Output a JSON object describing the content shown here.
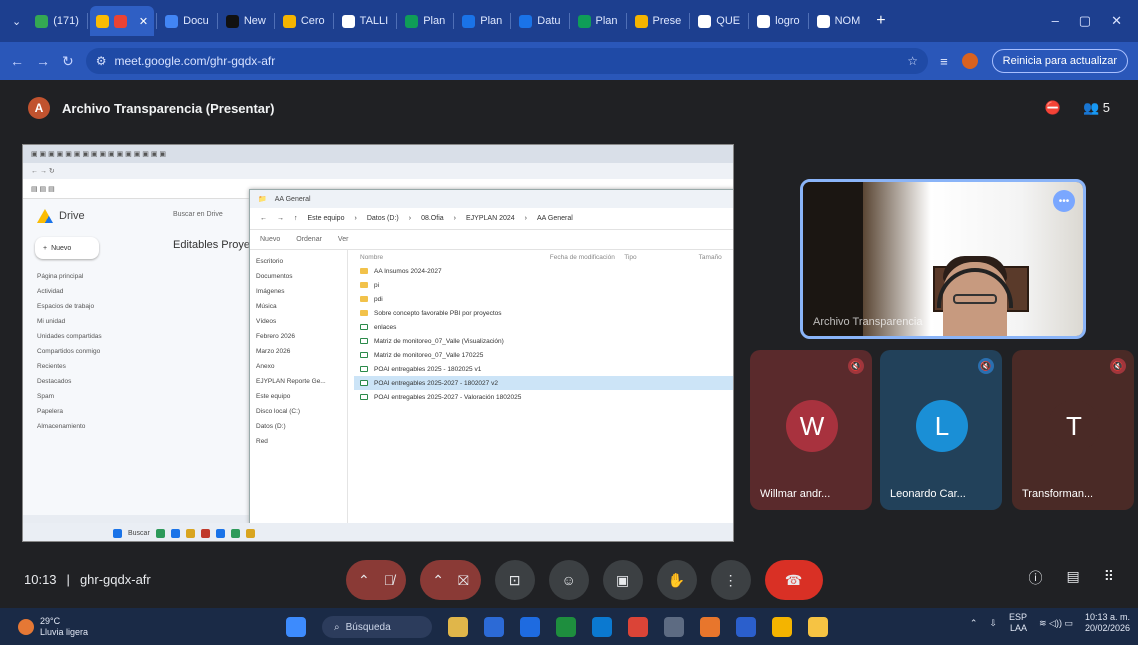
{
  "browser": {
    "tabs": [
      {
        "label": "(171)",
        "color": "#34a853",
        "active": false
      },
      {
        "label": "",
        "color": "#fbbc04",
        "active": true
      },
      {
        "label": "Docu",
        "color": "#4285f4",
        "active": false
      },
      {
        "label": "New",
        "color": "#111111",
        "active": false
      },
      {
        "label": "Cero",
        "color": "#f4b400",
        "active": false
      },
      {
        "label": "TALLI",
        "color": "#ffffff",
        "active": false
      },
      {
        "label": "Plan",
        "color": "#0f9d58",
        "active": false
      },
      {
        "label": "Plan",
        "color": "#1a73e8",
        "active": false
      },
      {
        "label": "Datu",
        "color": "#1a73e8",
        "active": false
      },
      {
        "label": "Plan",
        "color": "#0f9d58",
        "active": false
      },
      {
        "label": "Prese",
        "color": "#f4b400",
        "active": false
      },
      {
        "label": "QUE",
        "color": "#ffffff",
        "active": false
      },
      {
        "label": "logro",
        "color": "#ffffff",
        "active": false
      },
      {
        "label": "NOM",
        "color": "#ffffff",
        "active": false
      }
    ],
    "url": "meet.google.com/ghr-gqdx-afr",
    "update_label": "Reinicia para actualizar"
  },
  "meet": {
    "presenter_initial": "A",
    "presenting_title": "Archivo Transparencia (Presentar)",
    "participant_count": "5",
    "meeting_time": "10:13",
    "meeting_separator": "|",
    "meeting_code": "ghr-gqdx-afr",
    "self_tile": {
      "name": "Archivo Transparencia"
    },
    "participants": [
      {
        "initial": "W",
        "name": "Willmar andr...",
        "avatar_color": "#a8323e",
        "tile_color": "#5a2a2c",
        "mic_color": "#a0363c"
      },
      {
        "initial": "L",
        "name": "Leonardo Car...",
        "avatar_color": "#1a8fd6",
        "tile_color": "#22415a",
        "mic_color": "#2a6fb0"
      },
      {
        "initial": "T",
        "name": "Transforman...",
        "avatar_color": "#4a2a26",
        "tile_color": "#4a2a26",
        "mic_color": "#a0363c"
      }
    ]
  },
  "shared_screen": {
    "drive": {
      "logo": "Drive",
      "new_label": "Nuevo",
      "search_placeholder": "Buscar en Drive",
      "title": "Editables Proye",
      "nav": [
        "Página principal",
        "Actividad",
        "Espacios de trabajo",
        "Mi unidad",
        "Unidades compartidas",
        "Compartidos conmigo",
        "Recientes",
        "Destacados",
        "Spam",
        "Papelera",
        "Almacenamiento"
      ]
    },
    "explorer": {
      "window_title": "AA General",
      "breadcrumb": [
        "Este equipo",
        "Datos (D:)",
        "08.Ofia",
        "EJYPLAN 2024",
        "AA General"
      ],
      "toolbar": [
        "Nuevo",
        "Ordenar",
        "Ver"
      ],
      "columns": [
        "Nombre",
        "Fecha de modificación",
        "Tipo",
        "Tamaño"
      ],
      "left_nav": [
        "Escritorio",
        "Documentos",
        "Imágenes",
        "Música",
        "Vídeos",
        "Febrero 2026",
        "Marzo 2026",
        "Anexo",
        "EJYPLAN Reporte Ge...",
        "Este equipo",
        "Disco local (C:)",
        "Datos (D:)",
        "Red"
      ],
      "files": [
        {
          "name": "AA Insumos 2024-2027",
          "type": "folder"
        },
        {
          "name": "pi",
          "type": "folder"
        },
        {
          "name": "pdi",
          "type": "folder"
        },
        {
          "name": "Sobre concepto favorable PBI por proyectos",
          "type": "folder"
        },
        {
          "name": "enlaces",
          "type": "doc"
        },
        {
          "name": "Matriz de monitoreo_07_Valle (Visualización)",
          "type": "doc"
        },
        {
          "name": "Matriz de monitoreo_07_Valle 170225",
          "type": "doc"
        },
        {
          "name": "POAI entregables 2025 - 1802025 v1",
          "type": "doc"
        },
        {
          "name": "POAI entregables 2025-2027 - 1802027 v2",
          "type": "doc",
          "selected": true
        },
        {
          "name": "POAI entregables 2025-2027 - Valoración 1802025",
          "type": "doc"
        }
      ]
    },
    "taskbar_search": "Buscar"
  },
  "taskbar": {
    "temperature": "29°C",
    "weather_text": "Lluvia ligera",
    "search_label": "Búsqueda",
    "language": "ESP",
    "language_region": "LAA",
    "clock_time": "10:13 a. m.",
    "clock_date": "20/02/2026"
  }
}
